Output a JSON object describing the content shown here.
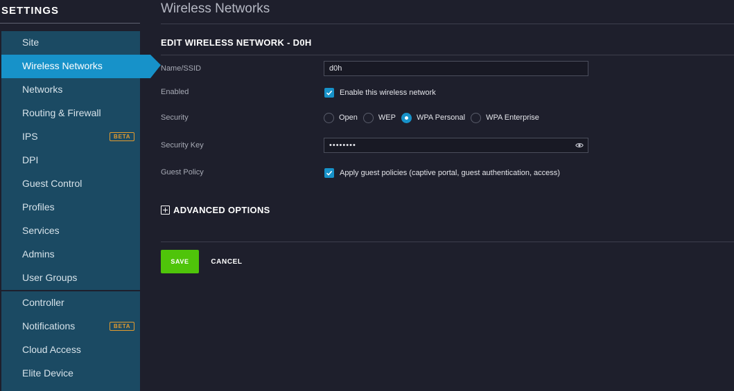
{
  "sidebar": {
    "title": "SETTINGS",
    "groups": [
      {
        "items": [
          {
            "label": "Site",
            "active": false
          },
          {
            "label": "Wireless Networks",
            "active": true
          },
          {
            "label": "Networks",
            "active": false
          },
          {
            "label": "Routing & Firewall",
            "active": false
          },
          {
            "label": "IPS",
            "active": false,
            "badge": "BETA"
          },
          {
            "label": "DPI",
            "active": false
          },
          {
            "label": "Guest Control",
            "active": false
          },
          {
            "label": "Profiles",
            "active": false
          },
          {
            "label": "Services",
            "active": false
          },
          {
            "label": "Admins",
            "active": false
          },
          {
            "label": "User Groups",
            "active": false
          }
        ]
      },
      {
        "items": [
          {
            "label": "Controller",
            "active": false
          },
          {
            "label": "Notifications",
            "active": false,
            "badge": "BETA"
          },
          {
            "label": "Cloud Access",
            "active": false
          },
          {
            "label": "Elite Device",
            "active": false
          }
        ]
      }
    ]
  },
  "main": {
    "page_title": "Wireless Networks",
    "section_title": "EDIT WIRELESS NETWORK - D0H",
    "form": {
      "name_label": "Name/SSID",
      "name_value": "d0h",
      "enabled_label": "Enabled",
      "enabled_checkbox_label": "Enable this wireless network",
      "enabled_checked": true,
      "security_label": "Security",
      "security_options": [
        "Open",
        "WEP",
        "WPA Personal",
        "WPA Enterprise"
      ],
      "security_selected": "WPA Personal",
      "security_key_label": "Security Key",
      "security_key_value": "••••••••",
      "guest_policy_label": "Guest Policy",
      "guest_policy_checkbox_label": "Apply guest policies (captive portal, guest authentication, access)",
      "guest_policy_checked": true
    },
    "advanced_label": "ADVANCED OPTIONS",
    "save_label": "SAVE",
    "cancel_label": "CANCEL"
  },
  "colors": {
    "background": "#1e1f2c",
    "sidebar_group": "#1b4a63",
    "accent": "#1792c9",
    "save_button": "#4fc40a",
    "beta_badge": "#e39c2f"
  },
  "icons": {
    "eye": "eye-icon",
    "check": "check-icon",
    "expand": "plus-square-icon"
  }
}
